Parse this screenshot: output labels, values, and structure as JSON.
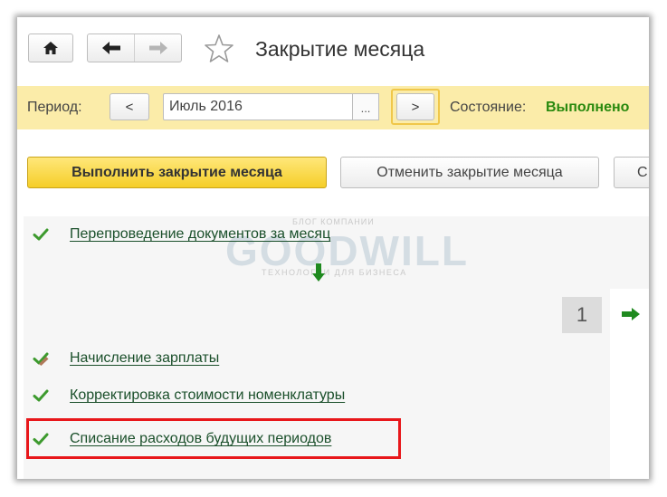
{
  "header": {
    "title": "Закрытие месяца",
    "home_icon": "home-icon",
    "back_icon": "arrow-left-icon",
    "forward_icon": "arrow-right-icon",
    "star_icon": "star-outline-icon"
  },
  "period_bar": {
    "period_label": "Период:",
    "prev_label": "<",
    "period_value": "Июль 2016",
    "pick_label": "...",
    "next_label": ">",
    "state_label": "Состояние:",
    "state_value": "Выполнено"
  },
  "toolbar": {
    "primary_label": "Выполнить закрытие месяца",
    "cancel_label": "Отменить закрытие месяца",
    "extra_label": "С"
  },
  "steps": [
    {
      "label": "Перепроведение документов за месяц",
      "status_icon": "check-icon"
    },
    {
      "label": "Начисление зарплаты",
      "status_icon": "check-pencil-icon"
    },
    {
      "label": "Корректировка стоимости номенклатуры",
      "status_icon": "check-icon"
    },
    {
      "label": "Списание расходов будущих периодов",
      "status_icon": "check-icon"
    }
  ],
  "stage_counter": "1",
  "watermark": {
    "top": "БЛОГ КОМПАНИИ",
    "main": "GOODWILL",
    "sub": "ТЕХНОЛОГИИ ДЛЯ БИЗНЕСА"
  },
  "colors": {
    "period_bar_bg": "#fbeca9",
    "primary_button": "#f5ce28",
    "status_done": "#29890e",
    "check": "#3d9a2e",
    "highlight_border": "#e8171b"
  }
}
